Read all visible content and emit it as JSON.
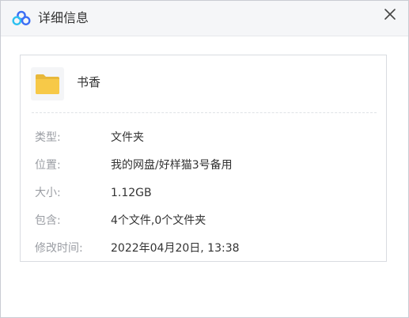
{
  "window": {
    "title": "详细信息",
    "logo_icon": "baidu-netdisk-logo-icon",
    "close_icon": "close-icon"
  },
  "file": {
    "icon": "folder-icon",
    "name": "书香"
  },
  "details": [
    {
      "label": "类型:",
      "value": "文件夹"
    },
    {
      "label": "位置:",
      "value": "我的网盘/好样猫3号备用"
    },
    {
      "label": "大小:",
      "value": "1.12GB"
    },
    {
      "label": "包含:",
      "value": "4个文件,0个文件夹"
    },
    {
      "label": "修改时间:",
      "value": "2022年04月20日, 13:38"
    }
  ],
  "colors": {
    "logo_blue": "#3b6ef5",
    "logo_cyan": "#2cc0f0",
    "folder_yellow": "#f7c948",
    "label_gray": "#9a9da3",
    "text": "#333333"
  }
}
